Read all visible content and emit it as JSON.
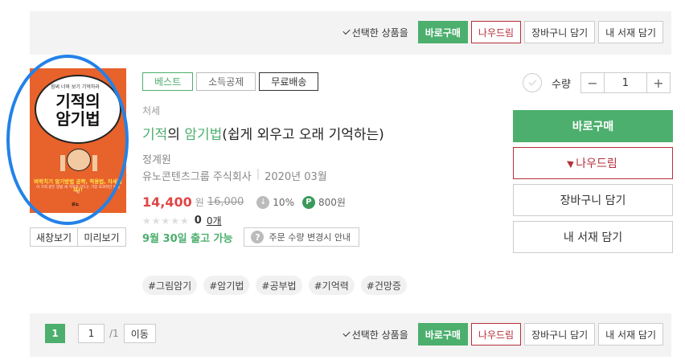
{
  "top_bar": {
    "select_label": "선택한 상품을",
    "buy_now": "바로구매",
    "gift": "나우드림",
    "cart": "장바구니 담기",
    "shelf": "내 서재 담기"
  },
  "cover": {
    "top_text": "힘써 너와 보기 기억하라",
    "title_line1": "기적의",
    "title_line2": "암기법",
    "subtitle": "벼락치기 암기방법 공략, 적용법, 자세정보!!",
    "small_text": "이 기적 같은 방법 세 가지로 만드는 가장 효과적인 학습법",
    "publisher_mark": "유노"
  },
  "view_buttons": {
    "new_window": "새창보기",
    "preview": "미리보기"
  },
  "badges": [
    "베스트",
    "소득공제",
    "무료배송"
  ],
  "product": {
    "category": "처세",
    "title_hl1": "기적",
    "title_mid": "의 ",
    "title_hl2": "암기법",
    "title_rest": "(쉽게 외우고 오래 기억하는)",
    "author": "정계원",
    "publisher": "유노콘텐츠그룹 주식회사",
    "pub_date": "2020년 03월",
    "price": "14,400",
    "price_unit": "원",
    "original_price": "16,000",
    "discount_icon": "↓",
    "discount": "10%",
    "points_icon": "P",
    "points": "800원",
    "stars": "★★★★★",
    "review_count": "0",
    "review_unit": "0개",
    "shipping": "9월 30일 출고 가능",
    "notice_icon": "?",
    "notice": "주문 수량 변경시 안내"
  },
  "tags": [
    "#그림암기",
    "#암기법",
    "#공부법",
    "#기억력",
    "#건망증"
  ],
  "quantity": {
    "label": "수량",
    "minus": "−",
    "value": "1",
    "plus": "+"
  },
  "side_buttons": {
    "buy_now": "바로구매",
    "gift": "나우드림",
    "cart": "장바구니 담기",
    "shelf": "내 서재 담기"
  },
  "bottom_bar": {
    "current_page": "1",
    "page_input": "1",
    "total_pages": "/1",
    "go": "이동",
    "select_label": "선택한 상품을",
    "buy_now": "바로구매",
    "gift": "나우드림",
    "cart": "장바구니 담기",
    "shelf": "내 서재 담기"
  },
  "colors": {
    "accent": "#4caf6d",
    "gift": "#b5303b",
    "price": "#e04646",
    "annotation": "#2382e8"
  }
}
